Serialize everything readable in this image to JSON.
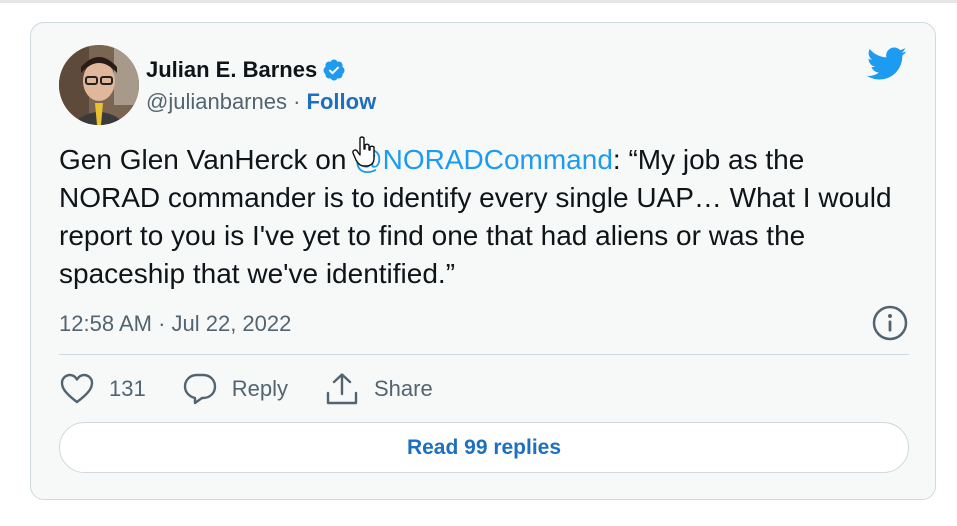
{
  "author": {
    "display_name": "Julian E. Barnes",
    "handle": "@julianbarnes",
    "separator": " · ",
    "follow_label": "Follow"
  },
  "tweet": {
    "text_before": "Gen Glen VanHerck on ",
    "mention": "@NORADCommand",
    "text_after": ": “My job as the NORAD commander is to identify every single UAP… What I would report to you is I've yet to find one that had aliens or was the spaceship that we've identified.”",
    "timestamp": "12:58 AM · Jul 22, 2022"
  },
  "actions": {
    "like_count": "131",
    "reply_label": "Reply",
    "share_label": "Share"
  },
  "read_replies_label": "Read 99 replies",
  "colors": {
    "accent": "#1d9bf0",
    "link_dark": "#1d6fbf",
    "text": "#0f1419",
    "muted": "#536471"
  },
  "icons": [
    "avatar",
    "verified-badge-icon",
    "twitter-bird-icon",
    "hand-cursor-icon",
    "info-icon",
    "heart-icon",
    "reply-icon",
    "share-icon"
  ]
}
